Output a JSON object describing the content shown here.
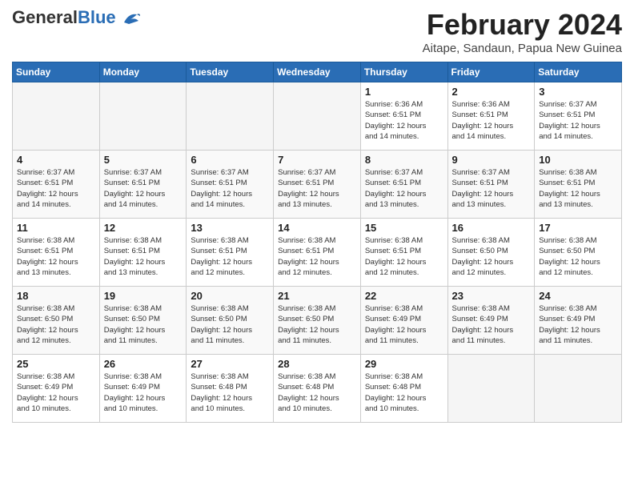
{
  "logo": {
    "general": "General",
    "blue": "Blue"
  },
  "title": "February 2024",
  "subtitle": "Aitape, Sandaun, Papua New Guinea",
  "days_of_week": [
    "Sunday",
    "Monday",
    "Tuesday",
    "Wednesday",
    "Thursday",
    "Friday",
    "Saturday"
  ],
  "weeks": [
    [
      {
        "day": "",
        "info": ""
      },
      {
        "day": "",
        "info": ""
      },
      {
        "day": "",
        "info": ""
      },
      {
        "day": "",
        "info": ""
      },
      {
        "day": "1",
        "info": "Sunrise: 6:36 AM\nSunset: 6:51 PM\nDaylight: 12 hours\nand 14 minutes."
      },
      {
        "day": "2",
        "info": "Sunrise: 6:36 AM\nSunset: 6:51 PM\nDaylight: 12 hours\nand 14 minutes."
      },
      {
        "day": "3",
        "info": "Sunrise: 6:37 AM\nSunset: 6:51 PM\nDaylight: 12 hours\nand 14 minutes."
      }
    ],
    [
      {
        "day": "4",
        "info": "Sunrise: 6:37 AM\nSunset: 6:51 PM\nDaylight: 12 hours\nand 14 minutes."
      },
      {
        "day": "5",
        "info": "Sunrise: 6:37 AM\nSunset: 6:51 PM\nDaylight: 12 hours\nand 14 minutes."
      },
      {
        "day": "6",
        "info": "Sunrise: 6:37 AM\nSunset: 6:51 PM\nDaylight: 12 hours\nand 14 minutes."
      },
      {
        "day": "7",
        "info": "Sunrise: 6:37 AM\nSunset: 6:51 PM\nDaylight: 12 hours\nand 13 minutes."
      },
      {
        "day": "8",
        "info": "Sunrise: 6:37 AM\nSunset: 6:51 PM\nDaylight: 12 hours\nand 13 minutes."
      },
      {
        "day": "9",
        "info": "Sunrise: 6:37 AM\nSunset: 6:51 PM\nDaylight: 12 hours\nand 13 minutes."
      },
      {
        "day": "10",
        "info": "Sunrise: 6:38 AM\nSunset: 6:51 PM\nDaylight: 12 hours\nand 13 minutes."
      }
    ],
    [
      {
        "day": "11",
        "info": "Sunrise: 6:38 AM\nSunset: 6:51 PM\nDaylight: 12 hours\nand 13 minutes."
      },
      {
        "day": "12",
        "info": "Sunrise: 6:38 AM\nSunset: 6:51 PM\nDaylight: 12 hours\nand 13 minutes."
      },
      {
        "day": "13",
        "info": "Sunrise: 6:38 AM\nSunset: 6:51 PM\nDaylight: 12 hours\nand 12 minutes."
      },
      {
        "day": "14",
        "info": "Sunrise: 6:38 AM\nSunset: 6:51 PM\nDaylight: 12 hours\nand 12 minutes."
      },
      {
        "day": "15",
        "info": "Sunrise: 6:38 AM\nSunset: 6:51 PM\nDaylight: 12 hours\nand 12 minutes."
      },
      {
        "day": "16",
        "info": "Sunrise: 6:38 AM\nSunset: 6:50 PM\nDaylight: 12 hours\nand 12 minutes."
      },
      {
        "day": "17",
        "info": "Sunrise: 6:38 AM\nSunset: 6:50 PM\nDaylight: 12 hours\nand 12 minutes."
      }
    ],
    [
      {
        "day": "18",
        "info": "Sunrise: 6:38 AM\nSunset: 6:50 PM\nDaylight: 12 hours\nand 12 minutes."
      },
      {
        "day": "19",
        "info": "Sunrise: 6:38 AM\nSunset: 6:50 PM\nDaylight: 12 hours\nand 11 minutes."
      },
      {
        "day": "20",
        "info": "Sunrise: 6:38 AM\nSunset: 6:50 PM\nDaylight: 12 hours\nand 11 minutes."
      },
      {
        "day": "21",
        "info": "Sunrise: 6:38 AM\nSunset: 6:50 PM\nDaylight: 12 hours\nand 11 minutes."
      },
      {
        "day": "22",
        "info": "Sunrise: 6:38 AM\nSunset: 6:49 PM\nDaylight: 12 hours\nand 11 minutes."
      },
      {
        "day": "23",
        "info": "Sunrise: 6:38 AM\nSunset: 6:49 PM\nDaylight: 12 hours\nand 11 minutes."
      },
      {
        "day": "24",
        "info": "Sunrise: 6:38 AM\nSunset: 6:49 PM\nDaylight: 12 hours\nand 11 minutes."
      }
    ],
    [
      {
        "day": "25",
        "info": "Sunrise: 6:38 AM\nSunset: 6:49 PM\nDaylight: 12 hours\nand 10 minutes."
      },
      {
        "day": "26",
        "info": "Sunrise: 6:38 AM\nSunset: 6:49 PM\nDaylight: 12 hours\nand 10 minutes."
      },
      {
        "day": "27",
        "info": "Sunrise: 6:38 AM\nSunset: 6:48 PM\nDaylight: 12 hours\nand 10 minutes."
      },
      {
        "day": "28",
        "info": "Sunrise: 6:38 AM\nSunset: 6:48 PM\nDaylight: 12 hours\nand 10 minutes."
      },
      {
        "day": "29",
        "info": "Sunrise: 6:38 AM\nSunset: 6:48 PM\nDaylight: 12 hours\nand 10 minutes."
      },
      {
        "day": "",
        "info": ""
      },
      {
        "day": "",
        "info": ""
      }
    ]
  ]
}
